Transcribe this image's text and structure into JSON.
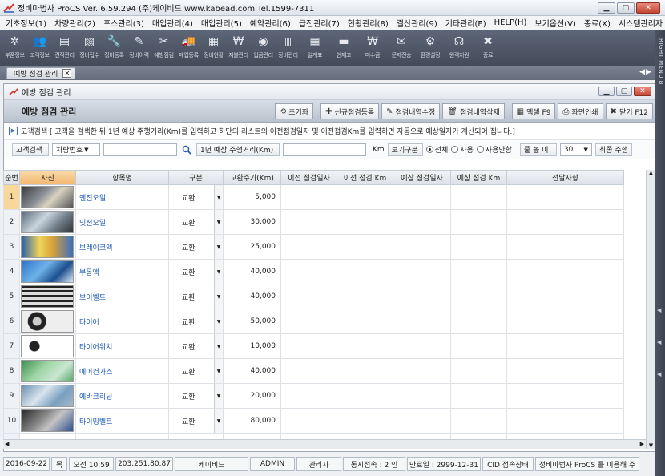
{
  "window": {
    "title": "정비마법사 ProCS  Ver. 6.59.294  (주)케이비드  www.kabead.com  Tel.1599-7311"
  },
  "menu": [
    "기초정보(1)",
    "차량관리(2)",
    "포스관리(3)",
    "매입관리(4)",
    "매입관리(5)",
    "예약관리(6)",
    "급전관리(7)",
    "현황관리(8)",
    "결산관리(9)",
    "기타관리(E)",
    "HELP(H)",
    "보기옵션(V)",
    "종료(X)",
    "시스템관리자"
  ],
  "toolbar": [
    {
      "icon": "gear-icon",
      "label": "부품정보"
    },
    {
      "icon": "users-icon",
      "label": "고객정보"
    },
    {
      "icon": "document-icon",
      "label": "견적관리"
    },
    {
      "icon": "clipboard-icon",
      "label": "정비접수"
    },
    {
      "icon": "wrench-icon",
      "label": "정비등록"
    },
    {
      "icon": "history-icon",
      "label": "정비이력"
    },
    {
      "icon": "tools-icon",
      "label": "예방점검"
    },
    {
      "icon": "truck-icon",
      "label": "매입등록"
    },
    {
      "icon": "chart-icon",
      "label": "정비현황"
    },
    {
      "icon": "money-icon",
      "label": "지불관리"
    },
    {
      "icon": "coin-icon",
      "label": "입금관리"
    },
    {
      "icon": "ledger-icon",
      "label": "장비관리"
    },
    {
      "icon": "calendar-icon",
      "label": "일계표"
    },
    {
      "icon": "box-icon",
      "label": "현재고"
    },
    {
      "icon": "receivable-icon",
      "label": "미수금"
    },
    {
      "icon": "sms-icon",
      "label": "문자전송"
    },
    {
      "icon": "settings-icon",
      "label": "환경설정"
    },
    {
      "icon": "headset-icon",
      "label": "원격지원"
    },
    {
      "icon": "exit-icon",
      "label": "종료"
    }
  ],
  "right_strip_label": "RIGHT MENU B",
  "doc_tab": {
    "label": "예방 점검 관리"
  },
  "inner_title": "예방 점검 관리",
  "form": {
    "title": "예방 점검 관리",
    "buttons": [
      {
        "icon": "reset-icon",
        "label": "초기화"
      },
      {
        "icon": "plus-icon",
        "label": "신규점검등록"
      },
      {
        "icon": "edit-icon",
        "label": "점검내역수정"
      },
      {
        "icon": "trash-icon",
        "label": "점검내역삭제"
      },
      {
        "icon": "excel-icon",
        "label": "엑셀 F9"
      },
      {
        "icon": "print-icon",
        "label": "화면인쇄"
      },
      {
        "icon": "close-icon",
        "label": "닫기 F12"
      }
    ]
  },
  "info_text": "고객검색 [ 고객을 검색한 뒤 1년 예상 주행거리(Km)를 입력하고 하단의 리스트의 이전점검일자 및 이전점검Km를 입력하면 자동으로 예상일자가 계산되어 집니다.]",
  "search": {
    "label": "고객검색",
    "mode": "차량번호",
    "distance_label": "1년 예상 주행거리(Km)",
    "km_unit": "Km",
    "view_label": "보기구분",
    "options": [
      "전체",
      "사용",
      "사용안함"
    ],
    "selected_option": "전체",
    "row_height_label": "줄 높 이",
    "row_height_value": "30",
    "last_label": "최종 주행"
  },
  "grid": {
    "headers": [
      "순번",
      "사진",
      "항목명",
      "구분",
      "교환주기(Km)",
      "이전 점검일자",
      "이전 점검 Km",
      "예상 점검일자",
      "예상 점검 Km",
      "전달사항"
    ],
    "rows": [
      {
        "no": "1",
        "name": "엔진오일",
        "kind": "교환",
        "cycle": "5,000",
        "photo": "engine-oil-photo"
      },
      {
        "no": "2",
        "name": "밋션오일",
        "kind": "교환",
        "cycle": "30,000",
        "photo": "transmission-oil-photo"
      },
      {
        "no": "3",
        "name": "브레이크액",
        "kind": "교환",
        "cycle": "25,000",
        "photo": "brake-fluid-photo"
      },
      {
        "no": "4",
        "name": "부동액",
        "kind": "교환",
        "cycle": "40,000",
        "photo": "antifreeze-photo"
      },
      {
        "no": "5",
        "name": "브이벨트",
        "kind": "교환",
        "cycle": "40,000",
        "photo": "v-belt-photo"
      },
      {
        "no": "6",
        "name": "타이어",
        "kind": "교환",
        "cycle": "50,000",
        "photo": "tire-photo"
      },
      {
        "no": "7",
        "name": "타이어위치",
        "kind": "교환",
        "cycle": "10,000",
        "photo": "tire-rotation-photo"
      },
      {
        "no": "8",
        "name": "에어컨가스",
        "kind": "교환",
        "cycle": "40,000",
        "photo": "aircon-gas-photo"
      },
      {
        "no": "9",
        "name": "에바크리닝",
        "kind": "교환",
        "cycle": "20,000",
        "photo": "evaporator-cleaning-photo"
      },
      {
        "no": "10",
        "name": "타이밍벨트",
        "kind": "교환",
        "cycle": "80,000",
        "photo": "timing-belt-photo"
      }
    ]
  },
  "status": [
    "2016-09-22",
    "목",
    "오전 10:59",
    "203.251.80.87",
    "케이비드",
    "ADMIN",
    "관리자",
    "동시접속 : 2 인",
    "만료일 : 2999-12-31",
    "CID 접속상태",
    "정비마법사 ProCS 를 이용해 주"
  ]
}
